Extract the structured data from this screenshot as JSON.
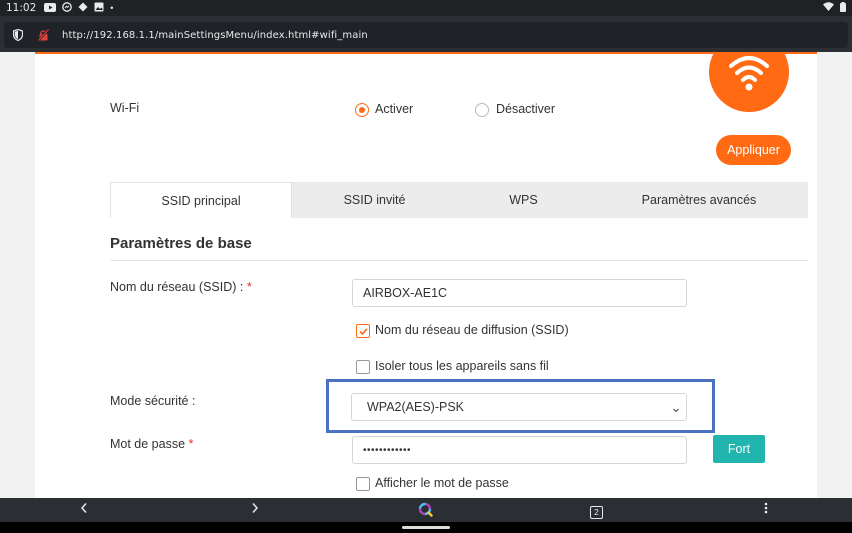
{
  "status_bar": {
    "time": "11:02",
    "dot": "•",
    "icons": [
      "youtube-icon",
      "messenger-icon",
      "cast-icon",
      "image-icon",
      "wifi-icon",
      "battery-icon"
    ]
  },
  "browser": {
    "url": "http://192.168.1.1/mainSettingsMenu/index.html#wifi_main"
  },
  "page": {
    "wifi": {
      "label": "Wi-Fi",
      "enable_label": "Activer",
      "disable_label": "Désactiver",
      "selected": "Activer"
    },
    "apply_label": "Appliquer",
    "tabs": [
      {
        "label": "SSID principal",
        "active": true
      },
      {
        "label": "SSID invité",
        "active": false
      },
      {
        "label": "WPS",
        "active": false
      },
      {
        "label": "Paramètres avancés",
        "active": false
      }
    ],
    "section_title": "Paramètres de base",
    "ssid": {
      "label": "Nom du réseau (SSID) :",
      "required_mark": "*",
      "value": "AIRBOX-AE1C"
    },
    "broadcast": {
      "label": "Nom du réseau de diffusion (SSID)",
      "checked": true
    },
    "isolate": {
      "label": "Isoler tous les appareils sans fil",
      "checked": false
    },
    "security": {
      "label": "Mode sécurité :",
      "value": "WPA2(AES)-PSK"
    },
    "password": {
      "label": "Mot de passe",
      "required_mark": "*",
      "value": "••••••••••••",
      "strength": "Fort"
    },
    "show_password": {
      "label": "Afficher le mot de passe",
      "checked": false
    }
  },
  "nav_bar": {
    "tab_count": "2"
  },
  "colors": {
    "accent": "#ff6a13",
    "teal": "#21b5ad",
    "highlight": "#4a72c1"
  }
}
